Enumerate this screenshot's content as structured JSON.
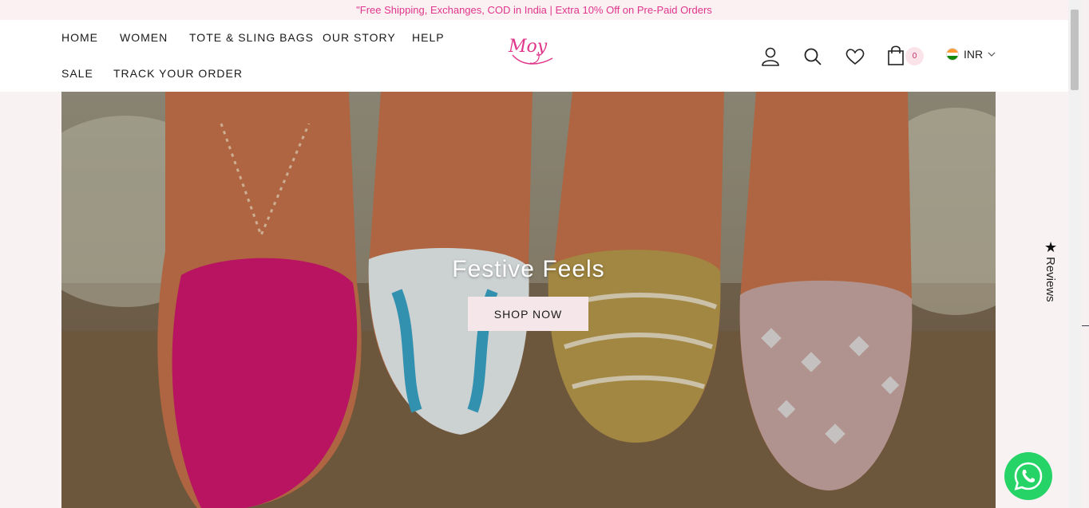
{
  "announcement": "\"Free Shipping, Exchanges, COD in India | Extra 10% Off on Pre-Paid Orders",
  "nav": {
    "home": "HOME",
    "women": "WOMEN",
    "tote": "TOTE & SLING BAGS",
    "story": "OUR STORY",
    "help": "HELP",
    "sale": "SALE",
    "track": "TRACK YOUR ORDER"
  },
  "logo": {
    "text": "Moy"
  },
  "header_icons": [
    "user-icon",
    "search-icon",
    "heart-icon",
    "shopping-bag-icon"
  ],
  "cart": {
    "count": "0"
  },
  "currency": {
    "label": "INR"
  },
  "hero": {
    "title": "Festive Feels",
    "button": "SHOP NOW"
  },
  "reviews_tab": {
    "label": "Reviews"
  },
  "colors": {
    "accent": "#e0358a",
    "announcement_bg": "#fbf1f3",
    "button_bg": "#f5e6ea",
    "whatsapp": "#25d366"
  }
}
